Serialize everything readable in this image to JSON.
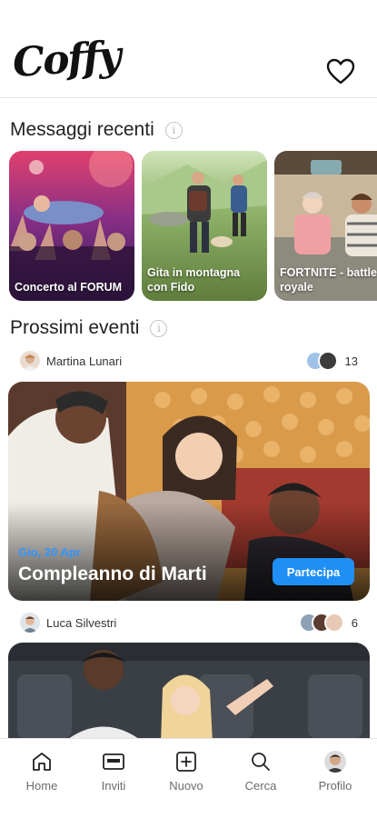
{
  "app": {
    "logo": "Coffy"
  },
  "icons": {
    "favorites": "heart-icon",
    "info": "info-icon"
  },
  "recent_messages": {
    "title": "Messaggi recenti",
    "info_symbol": "i",
    "items": [
      {
        "label": "Concerto al FORUM",
        "image": "concert-crowd"
      },
      {
        "label": "Gita in montagna con Fido",
        "image": "hikers-with-dog"
      },
      {
        "label": "FORTNITE - battle royale",
        "image": "friends-gaming"
      }
    ]
  },
  "upcoming_events": {
    "title": "Prossimi eventi",
    "info_symbol": "i",
    "events": [
      {
        "owner": "Martina Lunari",
        "attendee_count": "13",
        "date": "Gio, 20 Apr",
        "title": "Compleanno di Marti",
        "action": "Partecipa",
        "accent": "#1f8ff5"
      },
      {
        "owner": "Luca Silvestri",
        "attendee_count": "6",
        "image": "friends-at-cinema"
      }
    ]
  },
  "tabbar": {
    "items": [
      {
        "label": "Home",
        "icon": "home-icon"
      },
      {
        "label": "Inviti",
        "icon": "ticket-icon"
      },
      {
        "label": "Nuovo",
        "icon": "plus-square-icon"
      },
      {
        "label": "Cerca",
        "icon": "search-icon"
      },
      {
        "label": "Profilo",
        "icon": "avatar"
      }
    ]
  }
}
